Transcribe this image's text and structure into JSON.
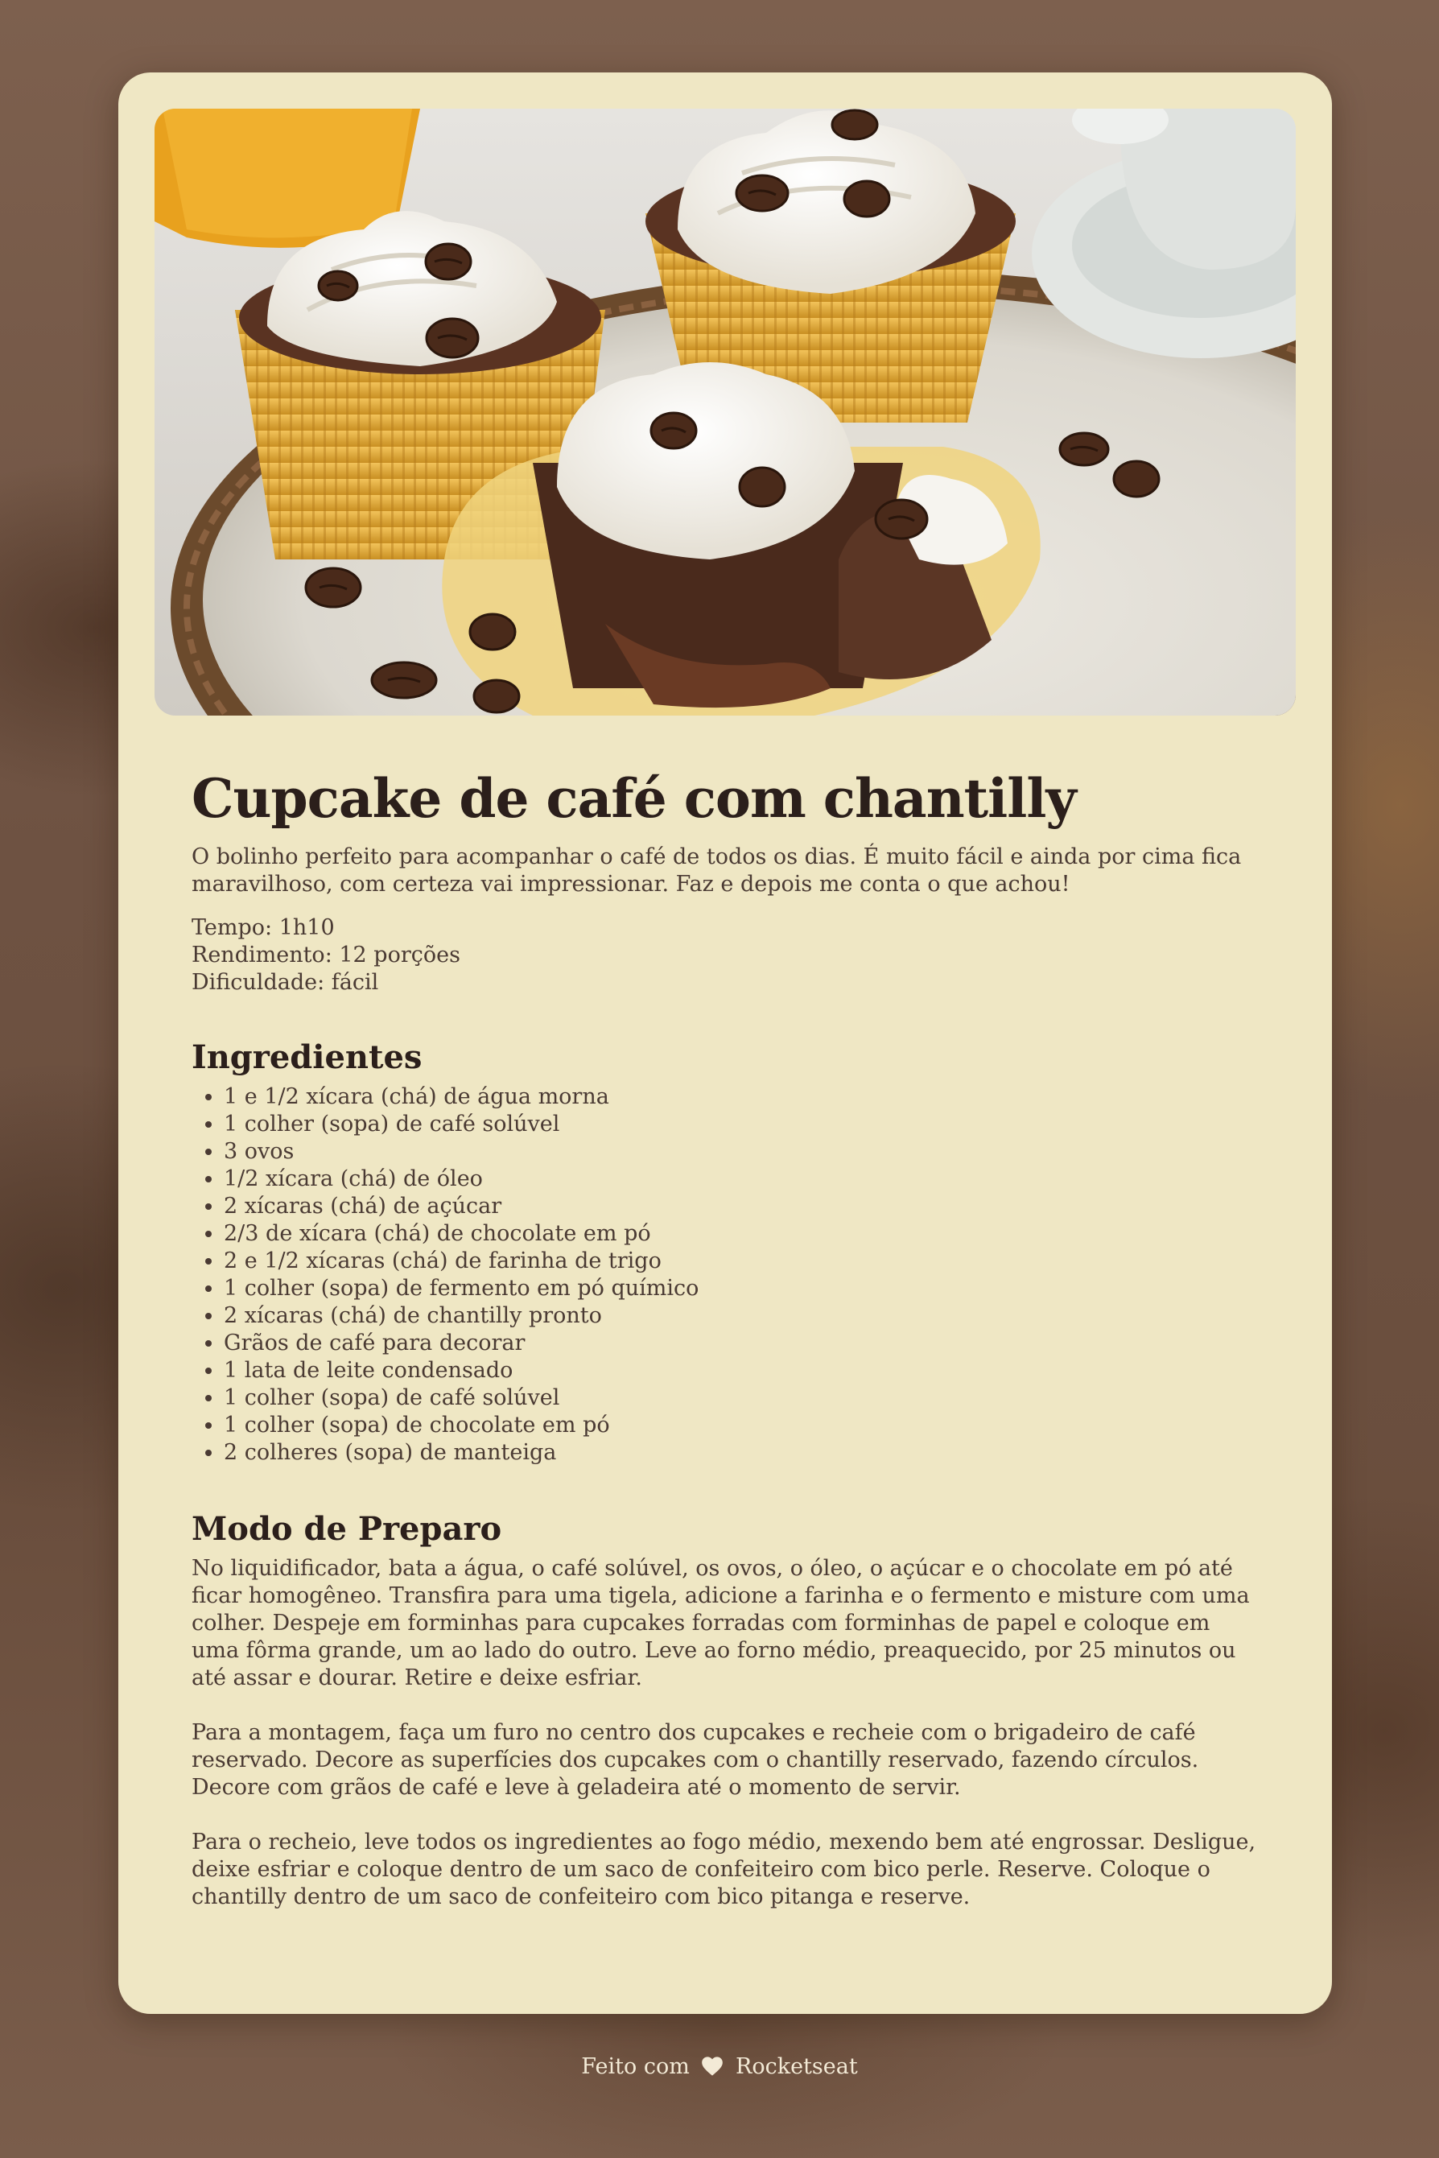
{
  "recipe": {
    "image_alt": "Cupcakes de café com chantilly e grãos de café",
    "title": "Cupcake de café com chantilly",
    "intro": "O bolinho perfeito para acompanhar o café de todos os dias. É muito fácil e ainda por cima fica maravilhoso, com certeza vai impressionar. Faz e depois me conta o que achou!",
    "meta": {
      "time": "Tempo: 1h10",
      "yield": "Rendimento: 12 porções",
      "difficulty": "Dificuldade: fácil"
    },
    "ingredients_title": "Ingredientes",
    "ingredients": [
      "1 e 1/2 xícara (chá) de água morna",
      "1 colher (sopa) de café solúvel",
      "3 ovos",
      "1/2 xícara (chá) de óleo",
      "2 xícaras (chá) de açúcar",
      "2/3 de xícara (chá) de chocolate em pó",
      "2 e 1/2 xícaras (chá) de farinha de trigo",
      "1 colher (sopa) de fermento em pó químico",
      "2 xícaras (chá) de chantilly pronto",
      "Grãos de café para decorar",
      "1 lata de leite condensado",
      "1 colher (sopa) de café solúvel",
      "1 colher (sopa) de chocolate em pó",
      "2 colheres (sopa) de manteiga"
    ],
    "preparation_title": "Modo de Preparo",
    "preparation": [
      "No liquidificador, bata a água, o café solúvel, os ovos, o óleo, o açúcar e o chocolate em pó até ficar homogêneo. Transfira para uma tigela, adicione a farinha e o fermento e misture com uma colher. Despeje em forminhas para cupcakes forradas com forminhas de papel e coloque em uma fôrma grande, um ao lado do outro. Leve ao forno médio, preaquecido, por 25 minutos ou até assar e dourar. Retire e deixe esfriar.",
      "Para a montagem, faça um furo no centro dos cupcakes e recheie com o brigadeiro de café reservado. Decore as superfícies dos cupcakes com o chantilly reservado, fazendo círculos. Decore com grãos de café e leve à geladeira até o momento de servir.",
      "Para o recheio, leve todos os ingredientes ao fogo médio, mexendo bem até engrossar. Desligue, deixe esfriar e coloque dentro de um saco de confeiteiro com bico perle. Reserve. Coloque o chantilly dentro de um saco de confeiteiro com bico pitanga e reserve."
    ]
  },
  "footer": {
    "prefix": "Feito com",
    "icon": "heart-icon",
    "brand": "Rocketseat"
  },
  "colors": {
    "card_background": "#efe7c4",
    "page_background": "#7a5d4b",
    "title_text": "#2b1f1b",
    "body_text": "#4a3a33",
    "footer_text": "#f3ead6"
  }
}
